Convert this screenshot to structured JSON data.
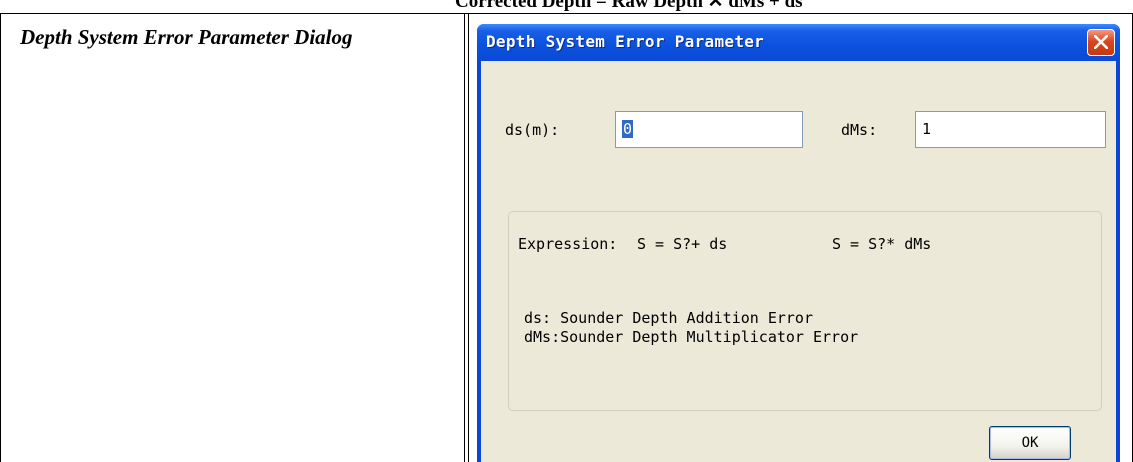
{
  "document": {
    "top_caption": "Corrected Depth = Raw Depth ✕ dMs + ds",
    "left_caption": "Depth System Error Parameter Dialog"
  },
  "dialog": {
    "title": "Depth System Error Parameter",
    "fields": {
      "ds_label": "ds(m):",
      "ds_value": "0",
      "dms_label": "dMs:",
      "dms_value": "1"
    },
    "groupbox": {
      "expression_prefix": "Expression:",
      "expression_1": "S = S?+ ds",
      "expression_2": "S = S?* dMs",
      "note_ds": "ds: Sounder Depth Addition Error",
      "note_dms": "dMs:Sounder Depth Multiplicator Error"
    },
    "ok_label": "OK"
  }
}
